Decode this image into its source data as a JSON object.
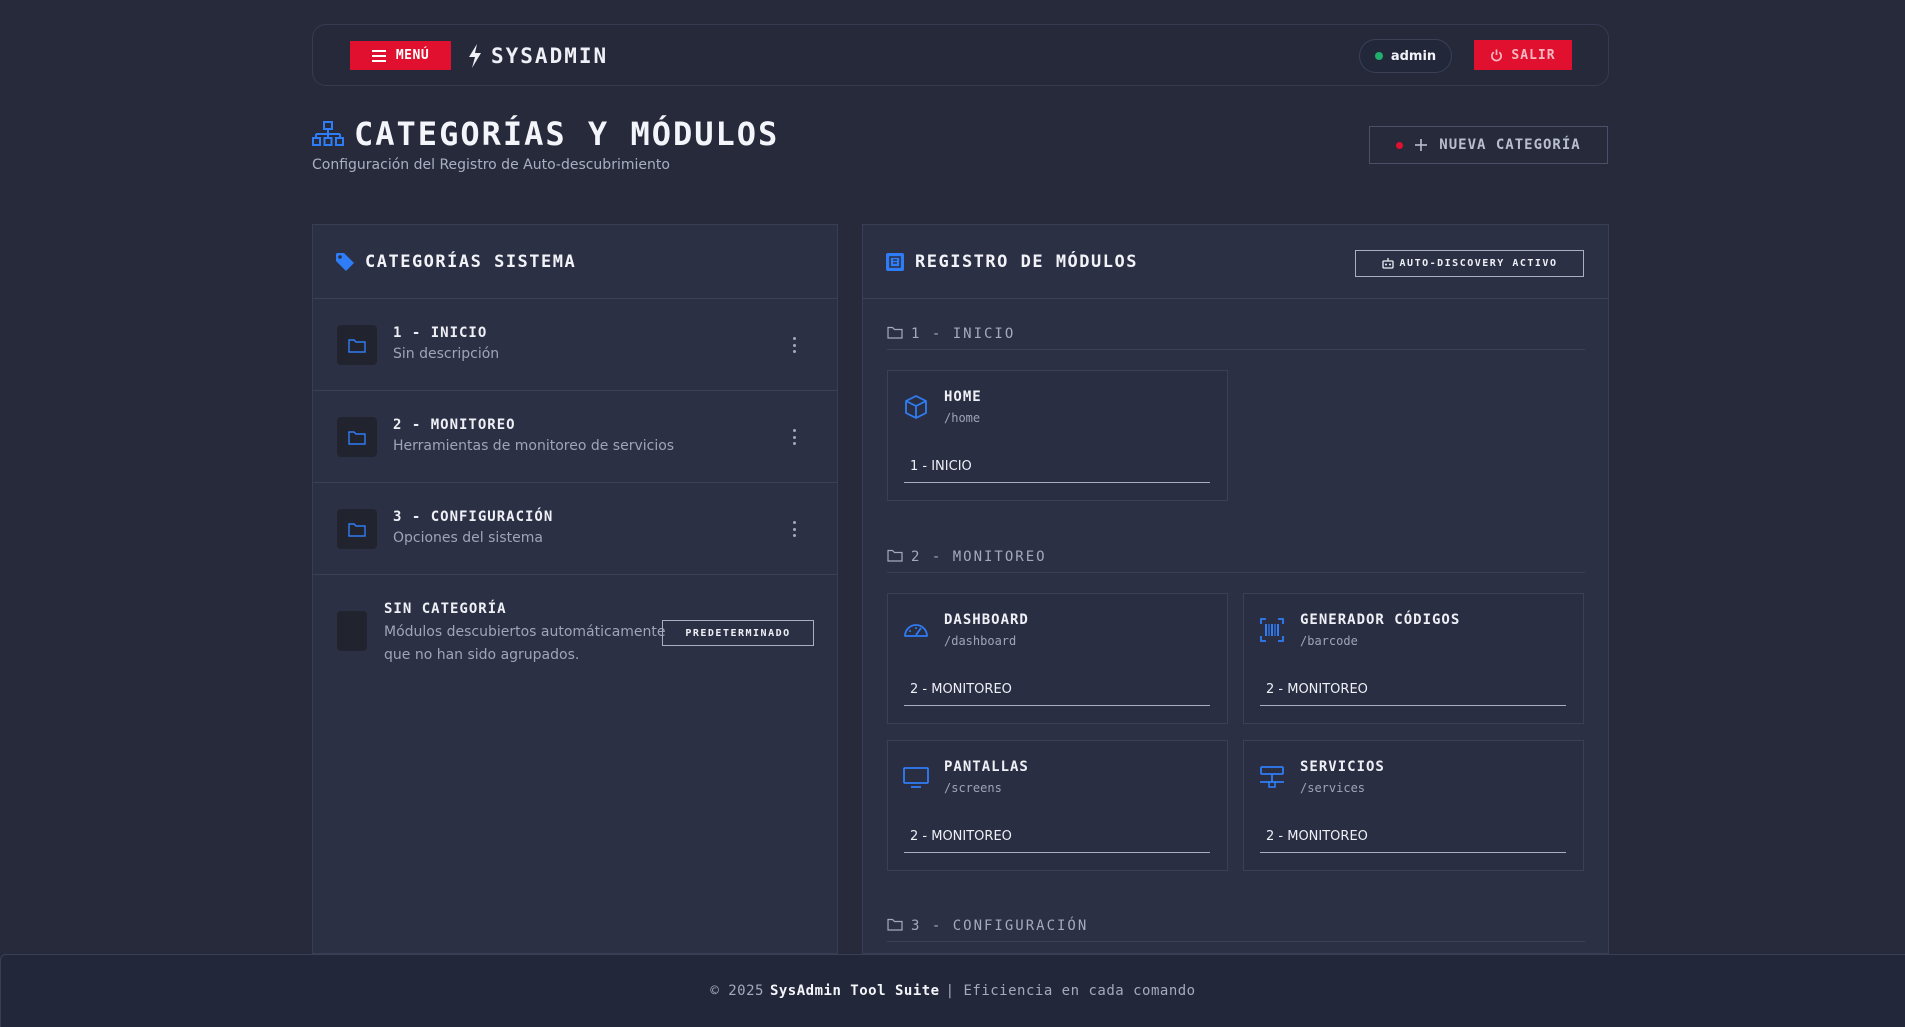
{
  "topbar": {
    "menu_label": "MENÚ",
    "brand": "SYSADMIN",
    "user": "admin",
    "logout_label": "SALIR"
  },
  "page": {
    "title": "CATEGORÍAS Y MÓDULOS",
    "subtitle": "Configuración del Registro de Auto-descubrimiento",
    "new_category_label": "NUEVA CATEGORÍA"
  },
  "categories_panel": {
    "title": "CATEGORÍAS SISTEMA",
    "items": [
      {
        "title": "1 - INICIO",
        "desc": "Sin descripción"
      },
      {
        "title": "2 - MONITOREO",
        "desc": "Herramientas de monitoreo de servicios"
      },
      {
        "title": "3 - CONFIGURACIÓN",
        "desc": "Opciones del sistema"
      }
    ],
    "uncategorized": {
      "title": "SIN CATEGORÍA",
      "desc": "Módulos descubiertos automáticamente que no han sido agrupados.",
      "badge": "PREDETERMINADO"
    }
  },
  "modules_panel": {
    "title": "REGISTRO DE MÓDULOS",
    "badge": "AUTO-DISCOVERY ACTIVO",
    "groups": [
      {
        "title": "1 - INICIO",
        "modules": [
          {
            "name": "HOME",
            "path": "/home",
            "category": "1 - INICIO",
            "icon": "cube-icon"
          }
        ]
      },
      {
        "title": "2 - MONITOREO",
        "modules": [
          {
            "name": "DASHBOARD",
            "path": "/dashboard",
            "category": "2 - MONITOREO",
            "icon": "gauge-icon"
          },
          {
            "name": "GENERADOR CÓDIGOS",
            "path": "/barcode",
            "category": "2 - MONITOREO",
            "icon": "barcode-icon"
          },
          {
            "name": "PANTALLAS",
            "path": "/screens",
            "category": "2 - MONITOREO",
            "icon": "monitor-icon"
          },
          {
            "name": "SERVICIOS",
            "path": "/services",
            "category": "2 - MONITOREO",
            "icon": "network-icon"
          }
        ]
      },
      {
        "title": "3 - CONFIGURACIÓN",
        "modules": []
      }
    ]
  },
  "footer": {
    "copyright": "© 2025",
    "product": "SysAdmin Tool Suite",
    "tagline": "| Eficiencia en cada comando"
  },
  "colors": {
    "accent_red": "#e0102e",
    "accent_blue": "#2f7df6",
    "status_green": "#1fae6b",
    "background": "#262a3b"
  }
}
